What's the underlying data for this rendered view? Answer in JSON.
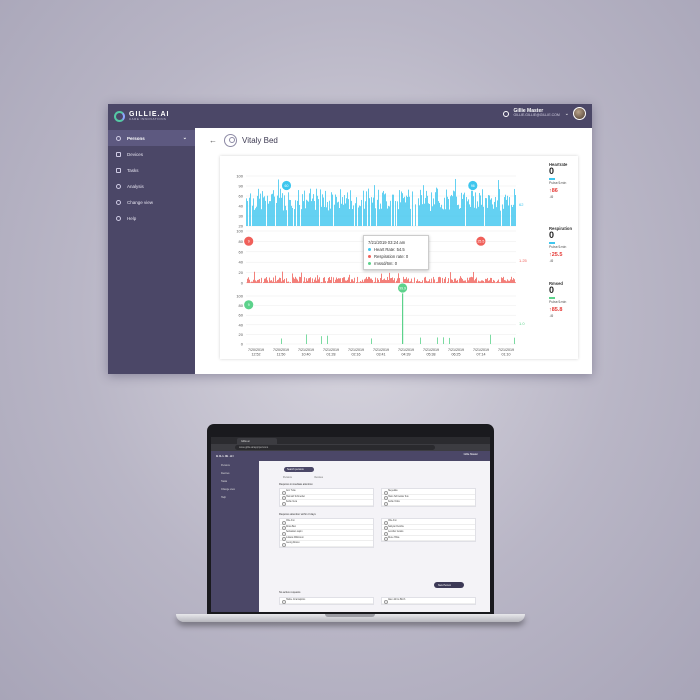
{
  "app": {
    "brand_name": "GILLIE.AI",
    "brand_tagline": "CARE INNOVATIONS",
    "user_name": "Gillie Master",
    "user_email": "GILLIE.GILLIE@GILLIE.COM"
  },
  "sidebar": {
    "items": [
      {
        "label": "Persons",
        "icon": "person-icon",
        "active": true
      },
      {
        "label": "Devices",
        "icon": "device-icon"
      },
      {
        "label": "Tasks",
        "icon": "tasks-icon"
      },
      {
        "label": "Analysis",
        "icon": "search-icon"
      },
      {
        "label": "Change view",
        "icon": "eye-icon"
      },
      {
        "label": "Help",
        "icon": "help-icon"
      }
    ]
  },
  "page": {
    "title": "Vitaly Bed"
  },
  "chart_data": [
    {
      "type": "bar",
      "name": "Heart Rate",
      "color": "#3ec6ee",
      "ylim": [
        0,
        100
      ],
      "yticks": [
        100,
        90,
        60,
        40,
        30,
        20
      ],
      "pins": [
        {
          "label": "60",
          "x": 0.15
        },
        {
          "label": "96",
          "x": 0.84
        }
      ],
      "side_label": "62"
    },
    {
      "type": "bar",
      "name": "Respiration rate",
      "color": "#f0605a",
      "ylim": [
        0,
        100
      ],
      "yticks": [
        100,
        80,
        60,
        40,
        20,
        0
      ],
      "pins": [
        {
          "label": "9",
          "x": 0.01
        },
        {
          "label": "12",
          "x": 0.57
        },
        {
          "label": "25.5",
          "x": 0.87
        }
      ],
      "side_label": "1.25"
    },
    {
      "type": "bar",
      "name": "Movement",
      "color": "#5cd28b",
      "ylim": [
        0,
        100
      ],
      "yticks": [
        100,
        80,
        60,
        40,
        20,
        0
      ],
      "pins": [
        {
          "label": "9",
          "x": 0.01
        },
        {
          "label": "99.9",
          "x": 0.58
        }
      ],
      "side_label": "1.0",
      "x_labels": [
        "7/20/2019 12:52",
        "7/20/2019 11:50",
        "7/21/2019 10:40",
        "7/21/2019 01:28",
        "7/21/2019 02:16",
        "7/21/2019 03:41",
        "7/21/2019 04:39",
        "7/21/2019 05:38",
        "7/21/2019 06:25",
        "7/21/2019 07:14",
        "7/21/2019 01:10"
      ]
    }
  ],
  "metrics": [
    {
      "name": "Heartrate",
      "value": "0",
      "unit": "Pulse/1min",
      "alert": "↑86",
      "low": "↓0",
      "bar": "blue"
    },
    {
      "name": "Respiration",
      "value": "0",
      "unit": "Pulse/1min",
      "alert": "↑25.5",
      "low": "↓0",
      "bar": "blue"
    },
    {
      "name": "Rmsed",
      "value": "0",
      "unit": "Pulse/1min",
      "alert": "↑85.8",
      "low": "↓0",
      "bar": "green"
    }
  ],
  "tooltip": {
    "time": "7/21/2019 03:24 am",
    "heart": "Heart Rate: 54.5",
    "resp": "Respiration rate: 0",
    "rms": "rmssd/6m: 0"
  },
  "laptop": {
    "tab_title": "Gillie.ai",
    "url": "www.gillie.ai/app/persons",
    "logo": "GILLIE.AI",
    "user": "Gillie Master",
    "side_items": [
      "Persons",
      "Devices",
      "Tasks",
      "Change view",
      "Help"
    ],
    "search": "Search persons",
    "tabs": [
      "Persons",
      "Devices"
    ],
    "section1": "Requires immediate attention",
    "section2": "Requires attention within 3 days",
    "section3": "No active requests",
    "left_rows_1": [
      "Ann Tuite",
      "Hannah Schneider",
      "Kellie Vera"
    ],
    "right_rows_1": [
      "Steyekka",
      "Hans Schneider Ilus",
      "Kellie Vinks"
    ],
    "left_rows_2": [
      "Olle Ann",
      "Rosa Ben",
      "Sebastian Lapin",
      "Juliana Wilkinson",
      "Georg Rosso"
    ],
    "right_rows_2": [
      "Olle Ann",
      "Sabyan Deirdre",
      "Jennifer Gooks",
      "Rune Hilka"
    ],
    "left_rows_3": [
      "Hattie Jorarrapkins"
    ],
    "right_rows_3": [
      "Alan Johns Birch"
    ],
    "new_button": "New Person"
  }
}
